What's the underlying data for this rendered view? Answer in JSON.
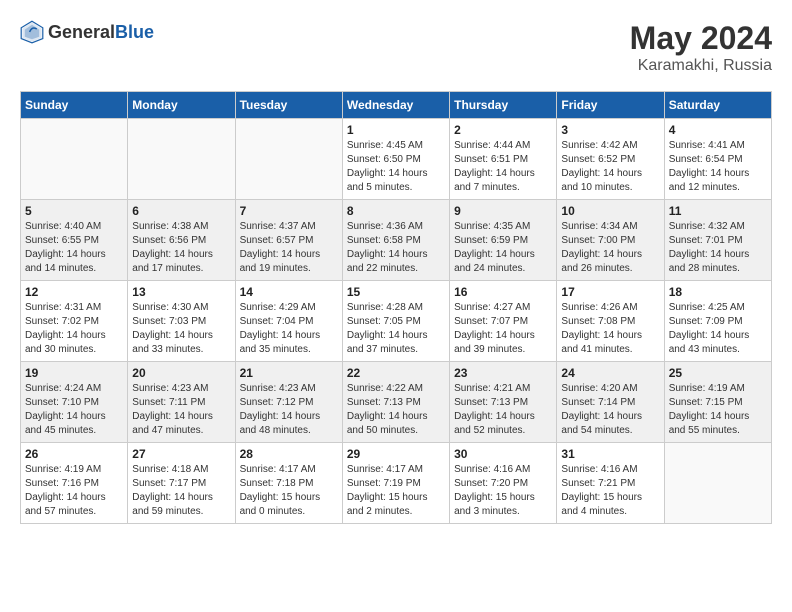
{
  "header": {
    "logo_general": "General",
    "logo_blue": "Blue",
    "month": "May 2024",
    "location": "Karamakhi, Russia"
  },
  "weekdays": [
    "Sunday",
    "Monday",
    "Tuesday",
    "Wednesday",
    "Thursday",
    "Friday",
    "Saturday"
  ],
  "weeks": [
    [
      {
        "day": "",
        "sunrise": "",
        "sunset": "",
        "daylight": ""
      },
      {
        "day": "",
        "sunrise": "",
        "sunset": "",
        "daylight": ""
      },
      {
        "day": "",
        "sunrise": "",
        "sunset": "",
        "daylight": ""
      },
      {
        "day": "1",
        "sunrise": "4:45 AM",
        "sunset": "6:50 PM",
        "daylight": "14 hours and 5 minutes."
      },
      {
        "day": "2",
        "sunrise": "4:44 AM",
        "sunset": "6:51 PM",
        "daylight": "14 hours and 7 minutes."
      },
      {
        "day": "3",
        "sunrise": "4:42 AM",
        "sunset": "6:52 PM",
        "daylight": "14 hours and 10 minutes."
      },
      {
        "day": "4",
        "sunrise": "4:41 AM",
        "sunset": "6:54 PM",
        "daylight": "14 hours and 12 minutes."
      }
    ],
    [
      {
        "day": "5",
        "sunrise": "4:40 AM",
        "sunset": "6:55 PM",
        "daylight": "14 hours and 14 minutes."
      },
      {
        "day": "6",
        "sunrise": "4:38 AM",
        "sunset": "6:56 PM",
        "daylight": "14 hours and 17 minutes."
      },
      {
        "day": "7",
        "sunrise": "4:37 AM",
        "sunset": "6:57 PM",
        "daylight": "14 hours and 19 minutes."
      },
      {
        "day": "8",
        "sunrise": "4:36 AM",
        "sunset": "6:58 PM",
        "daylight": "14 hours and 22 minutes."
      },
      {
        "day": "9",
        "sunrise": "4:35 AM",
        "sunset": "6:59 PM",
        "daylight": "14 hours and 24 minutes."
      },
      {
        "day": "10",
        "sunrise": "4:34 AM",
        "sunset": "7:00 PM",
        "daylight": "14 hours and 26 minutes."
      },
      {
        "day": "11",
        "sunrise": "4:32 AM",
        "sunset": "7:01 PM",
        "daylight": "14 hours and 28 minutes."
      }
    ],
    [
      {
        "day": "12",
        "sunrise": "4:31 AM",
        "sunset": "7:02 PM",
        "daylight": "14 hours and 30 minutes."
      },
      {
        "day": "13",
        "sunrise": "4:30 AM",
        "sunset": "7:03 PM",
        "daylight": "14 hours and 33 minutes."
      },
      {
        "day": "14",
        "sunrise": "4:29 AM",
        "sunset": "7:04 PM",
        "daylight": "14 hours and 35 minutes."
      },
      {
        "day": "15",
        "sunrise": "4:28 AM",
        "sunset": "7:05 PM",
        "daylight": "14 hours and 37 minutes."
      },
      {
        "day": "16",
        "sunrise": "4:27 AM",
        "sunset": "7:07 PM",
        "daylight": "14 hours and 39 minutes."
      },
      {
        "day": "17",
        "sunrise": "4:26 AM",
        "sunset": "7:08 PM",
        "daylight": "14 hours and 41 minutes."
      },
      {
        "day": "18",
        "sunrise": "4:25 AM",
        "sunset": "7:09 PM",
        "daylight": "14 hours and 43 minutes."
      }
    ],
    [
      {
        "day": "19",
        "sunrise": "4:24 AM",
        "sunset": "7:10 PM",
        "daylight": "14 hours and 45 minutes."
      },
      {
        "day": "20",
        "sunrise": "4:23 AM",
        "sunset": "7:11 PM",
        "daylight": "14 hours and 47 minutes."
      },
      {
        "day": "21",
        "sunrise": "4:23 AM",
        "sunset": "7:12 PM",
        "daylight": "14 hours and 48 minutes."
      },
      {
        "day": "22",
        "sunrise": "4:22 AM",
        "sunset": "7:13 PM",
        "daylight": "14 hours and 50 minutes."
      },
      {
        "day": "23",
        "sunrise": "4:21 AM",
        "sunset": "7:13 PM",
        "daylight": "14 hours and 52 minutes."
      },
      {
        "day": "24",
        "sunrise": "4:20 AM",
        "sunset": "7:14 PM",
        "daylight": "14 hours and 54 minutes."
      },
      {
        "day": "25",
        "sunrise": "4:19 AM",
        "sunset": "7:15 PM",
        "daylight": "14 hours and 55 minutes."
      }
    ],
    [
      {
        "day": "26",
        "sunrise": "4:19 AM",
        "sunset": "7:16 PM",
        "daylight": "14 hours and 57 minutes."
      },
      {
        "day": "27",
        "sunrise": "4:18 AM",
        "sunset": "7:17 PM",
        "daylight": "14 hours and 59 minutes."
      },
      {
        "day": "28",
        "sunrise": "4:17 AM",
        "sunset": "7:18 PM",
        "daylight": "15 hours and 0 minutes."
      },
      {
        "day": "29",
        "sunrise": "4:17 AM",
        "sunset": "7:19 PM",
        "daylight": "15 hours and 2 minutes."
      },
      {
        "day": "30",
        "sunrise": "4:16 AM",
        "sunset": "7:20 PM",
        "daylight": "15 hours and 3 minutes."
      },
      {
        "day": "31",
        "sunrise": "4:16 AM",
        "sunset": "7:21 PM",
        "daylight": "15 hours and 4 minutes."
      },
      {
        "day": "",
        "sunrise": "",
        "sunset": "",
        "daylight": ""
      }
    ]
  ]
}
